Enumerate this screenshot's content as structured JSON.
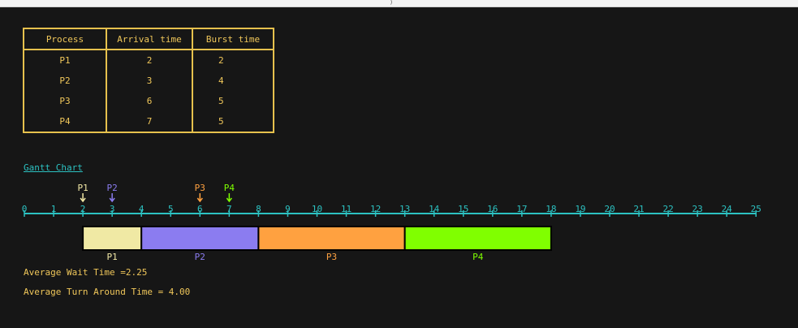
{
  "table": {
    "headers": [
      "Process",
      "Arrival time",
      "Burst time"
    ],
    "rows": [
      {
        "process": "P1",
        "arrival": "2",
        "burst": "2"
      },
      {
        "process": "P2",
        "arrival": "3",
        "burst": "4"
      },
      {
        "process": "P3",
        "arrival": "6",
        "burst": "5"
      },
      {
        "process": "P4",
        "arrival": "7",
        "burst": "5"
      }
    ]
  },
  "gantt": {
    "title": "Gantt Chart",
    "ticks": [
      0,
      1,
      2,
      3,
      4,
      5,
      6,
      7,
      8,
      9,
      10,
      11,
      12,
      13,
      14,
      15,
      16,
      17,
      18,
      19,
      20,
      21,
      22,
      23,
      24,
      25
    ],
    "arrivals": [
      {
        "label": "P1",
        "time": 2,
        "color": "#f3e9a6"
      },
      {
        "label": "P2",
        "time": 3,
        "color": "#8b7cf0"
      },
      {
        "label": "P3",
        "time": 6,
        "color": "#ffa140"
      },
      {
        "label": "P4",
        "time": 7,
        "color": "#7fff00"
      }
    ],
    "blocks": [
      {
        "label": "P1",
        "start": 2,
        "end": 4,
        "fill": "#f0e9a4",
        "text_color": "#f3e9a6"
      },
      {
        "label": "P2",
        "start": 4,
        "end": 8,
        "fill": "#8b7cf0",
        "text_color": "#8b7cf0"
      },
      {
        "label": "P3",
        "start": 8,
        "end": 13,
        "fill": "#ffa140",
        "text_color": "#ffa140"
      },
      {
        "label": "P4",
        "start": 13,
        "end": 18,
        "fill": "#80ff00",
        "text_color": "#7fff00"
      }
    ],
    "axis_color": "#2cc2c2"
  },
  "stats": {
    "avg_wait": "Average Wait Time =2.25",
    "avg_turnaround": "Average Turn Around Time = 4.00"
  }
}
